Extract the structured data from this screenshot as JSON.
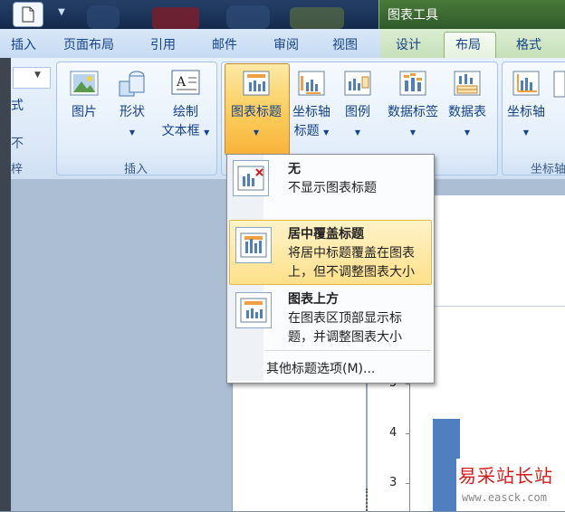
{
  "title_bar": {
    "context_title": "图表工具"
  },
  "tabs": [
    "插入",
    "页面布局",
    "引用",
    "邮件",
    "审阅",
    "视图",
    "设计",
    "布局",
    "格式"
  ],
  "ribbon": {
    "insert_group": {
      "label": "插入",
      "buttons": [
        {
          "label": "图片"
        },
        {
          "label": "形状"
        },
        {
          "label_line1": "绘制",
          "label_line2": "文本框"
        }
      ]
    },
    "labels_group": {
      "buttons": [
        {
          "label": "图表标题"
        },
        {
          "label_line1": "坐标轴",
          "label_line2": "标题"
        },
        {
          "label": "图例"
        },
        {
          "label": "数据标签"
        },
        {
          "label": "数据表"
        }
      ]
    },
    "axes_group": {
      "label": "坐标轴",
      "button": "坐标轴"
    }
  },
  "left_fragments": [
    "式",
    "不",
    "梓"
  ],
  "dropdown": {
    "items": [
      {
        "title": "无",
        "desc_line1": "不显示图表标题"
      },
      {
        "title": "居中覆盖标题",
        "desc_line1": "将居中标题覆盖在图表",
        "desc_line2": "上，但不调整图表大小",
        "highlighted": true
      },
      {
        "title": "图表上方",
        "desc_line1": "在图表区顶部显示标",
        "desc_line2": "题，并调整图表大小"
      }
    ],
    "more": "其他标题选项(M)..."
  },
  "chart": {
    "ticks": [
      "5",
      "4",
      "3"
    ],
    "bar_value": 4.3,
    "axis_min": 2.7,
    "axis_max": 5.1
  },
  "watermark": {
    "title": "易采站长站",
    "url": "www.easck.com"
  },
  "colors": {
    "accent_hover": "#fbcf60",
    "ribbon_text": "#15428b",
    "bar": "#4f7fbf",
    "watermark": "#d71a1a"
  }
}
